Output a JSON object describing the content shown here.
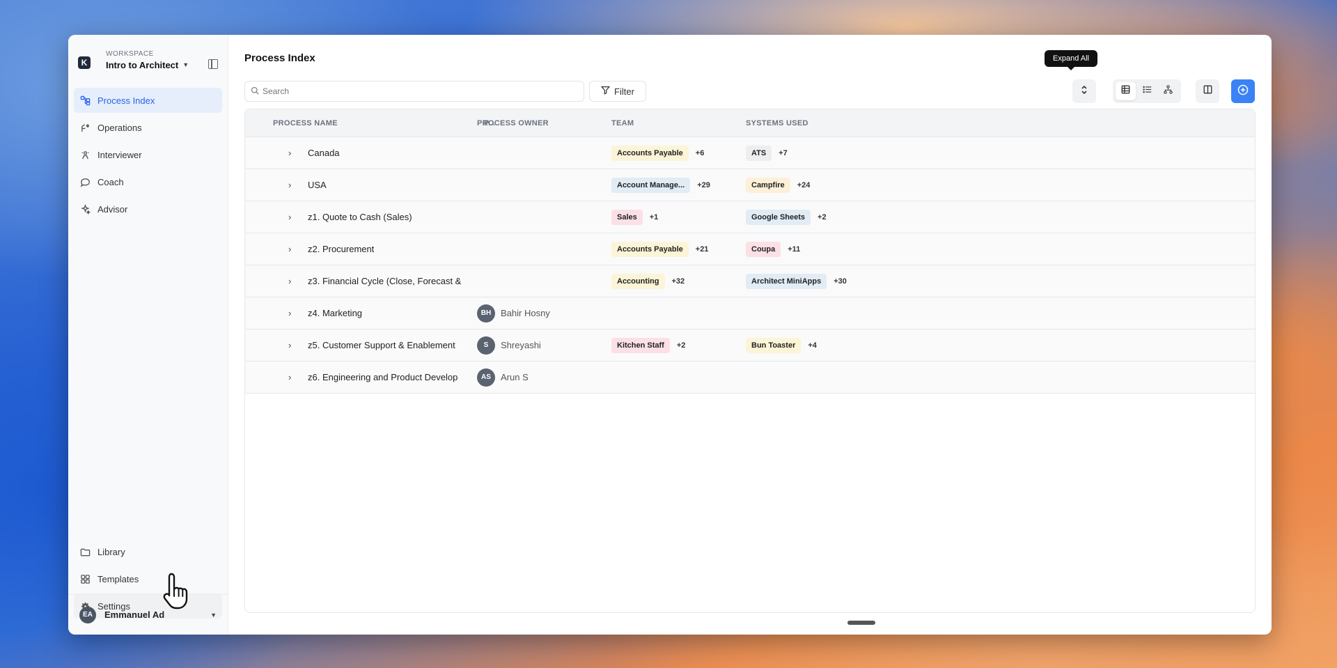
{
  "workspace": {
    "label": "WORKSPACE",
    "name": "Intro to Architect",
    "logo": "K"
  },
  "sidebar": {
    "items": [
      {
        "label": "Process Index",
        "icon": "process-index-icon"
      },
      {
        "label": "Operations",
        "icon": "operations-icon"
      },
      {
        "label": "Interviewer",
        "icon": "interviewer-icon"
      },
      {
        "label": "Coach",
        "icon": "coach-icon"
      },
      {
        "label": "Advisor",
        "icon": "advisor-icon"
      }
    ],
    "bottom": [
      {
        "label": "Library",
        "icon": "folder-icon"
      },
      {
        "label": "Templates",
        "icon": "templates-icon"
      },
      {
        "label": "Settings",
        "icon": "gear-icon"
      }
    ]
  },
  "user": {
    "initials": "EA",
    "name": "Emmanuel Ad"
  },
  "main": {
    "title": "Process Index",
    "search_placeholder": "Search",
    "filter_label": "Filter",
    "tooltip": "Expand All"
  },
  "table": {
    "headers": {
      "name": "PROCESS NAME",
      "p": "P...",
      "owner": "PROCESS OWNER",
      "team": "TEAM",
      "systems": "SYSTEMS USED"
    },
    "rows": [
      {
        "name": "Canada",
        "owner_initials": "",
        "owner": "",
        "team": "Accounts Payable",
        "team_color": "yellow",
        "team_more": "+6",
        "system": "ATS",
        "system_color": "gray",
        "system_more": "+7"
      },
      {
        "name": "USA",
        "owner_initials": "",
        "owner": "",
        "team": "Account Manage...",
        "team_color": "blue",
        "team_more": "+29",
        "system": "Campfire",
        "system_color": "orange",
        "system_more": "+24"
      },
      {
        "name": "z1. Quote to Cash (Sales)",
        "owner_initials": "",
        "owner": "",
        "team": "Sales",
        "team_color": "pink",
        "team_more": "+1",
        "system": "Google Sheets",
        "system_color": "blue",
        "system_more": "+2"
      },
      {
        "name": "z2. Procurement",
        "owner_initials": "",
        "owner": "",
        "team": "Accounts Payable",
        "team_color": "yellow",
        "team_more": "+21",
        "system": "Coupa",
        "system_color": "pink",
        "system_more": "+11"
      },
      {
        "name": "z3. Financial Cycle (Close, Forecast &",
        "owner_initials": "",
        "owner": "",
        "team": "Accounting",
        "team_color": "yellow",
        "team_more": "+32",
        "system": "Architect MiniApps",
        "system_color": "blue",
        "system_more": "+30"
      },
      {
        "name": "z4. Marketing",
        "owner_initials": "BH",
        "owner": "Bahir Hosny",
        "team": "",
        "team_color": "",
        "team_more": "",
        "system": "",
        "system_color": "",
        "system_more": ""
      },
      {
        "name": "z5. Customer Support & Enablement",
        "owner_initials": "S",
        "owner": "Shreyashi",
        "team": "Kitchen Staff",
        "team_color": "pink",
        "team_more": "+2",
        "system": "Bun Toaster",
        "system_color": "yellow",
        "system_more": "+4"
      },
      {
        "name": "z6. Engineering and Product Develop",
        "owner_initials": "AS",
        "owner": "Arun S",
        "team": "",
        "team_color": "",
        "team_more": "",
        "system": "",
        "system_color": "",
        "system_more": ""
      }
    ]
  },
  "colors": {
    "accent": "#3b82f6",
    "active_nav_bg": "#e6eefc",
    "active_nav_text": "#2563eb"
  }
}
